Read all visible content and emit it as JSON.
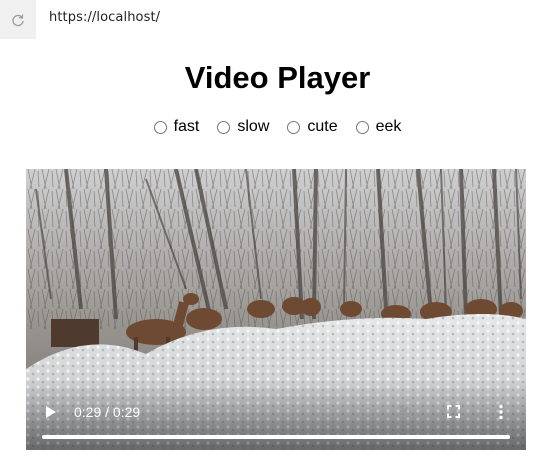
{
  "browser": {
    "url": "https://localhost/",
    "reload_icon": "reload-icon"
  },
  "page": {
    "title": "Video Player"
  },
  "speed_options": [
    {
      "label": "fast"
    },
    {
      "label": "slow"
    },
    {
      "label": "cute"
    },
    {
      "label": "eek"
    }
  ],
  "video": {
    "time_display": "0:29 / 0:29",
    "progress_fraction": 1.0,
    "icons": {
      "play": "play-icon",
      "mute": "muted-icon",
      "fullscreen": "fullscreen-icon",
      "menu": "more-options-icon"
    }
  },
  "colors": {
    "control_text": "#ffffff",
    "radio_border": "#767676"
  }
}
